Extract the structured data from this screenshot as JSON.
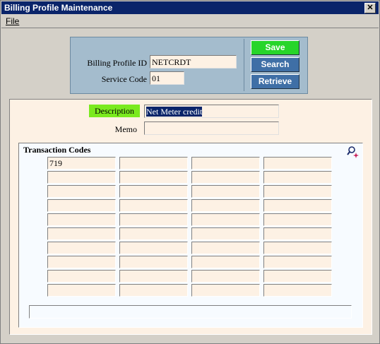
{
  "window": {
    "title": "Billing Profile Maintenance",
    "close_glyph": "✕"
  },
  "menu": {
    "file": "File"
  },
  "id_panel": {
    "billing_profile_id_label": "Billing Profile ID",
    "billing_profile_id_value": "NETCRDT",
    "service_code_label": "Service Code",
    "service_code_value": "01"
  },
  "buttons": {
    "save": "Save",
    "search": "Search",
    "retrieve": "Retrieve"
  },
  "details": {
    "description_label": "Description",
    "description_value": "Net Meter credit",
    "memo_label": "Memo",
    "memo_value": ""
  },
  "transaction_codes": {
    "title": "Transaction Codes",
    "search_icon": "magnify-sparkle-icon",
    "rows": [
      [
        "719",
        "",
        "",
        ""
      ],
      [
        "",
        "",
        "",
        ""
      ],
      [
        "",
        "",
        "",
        ""
      ],
      [
        "",
        "",
        "",
        ""
      ],
      [
        "",
        "",
        "",
        ""
      ],
      [
        "",
        "",
        "",
        ""
      ],
      [
        "",
        "",
        "",
        ""
      ],
      [
        "",
        "",
        "",
        ""
      ],
      [
        "",
        "",
        "",
        ""
      ],
      [
        "",
        "",
        "",
        ""
      ]
    ],
    "status_text": ""
  },
  "colors": {
    "title_bar": "#0a246a",
    "id_panel": "#a4bccd",
    "save_button": "#27d52a",
    "blue_button": "#3f6fa6",
    "description_highlight": "#7aea1e",
    "field_bg": "#fdf1e4"
  }
}
